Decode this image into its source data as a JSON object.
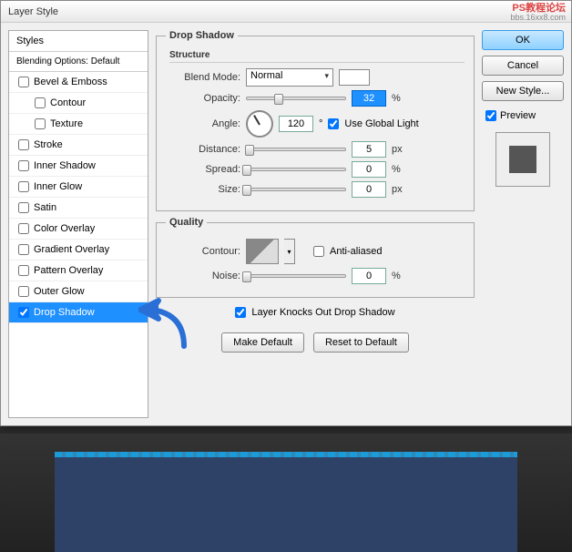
{
  "window": {
    "title": "Layer Style"
  },
  "watermark": {
    "line1": "PS教程论坛",
    "line2": "bbs.16xx8.com"
  },
  "styles": {
    "header": "Styles",
    "blending": "Blending Options: Default",
    "items": [
      {
        "label": "Bevel & Emboss",
        "checked": false,
        "indent": false
      },
      {
        "label": "Contour",
        "checked": false,
        "indent": true
      },
      {
        "label": "Texture",
        "checked": false,
        "indent": true
      },
      {
        "label": "Stroke",
        "checked": false,
        "indent": false
      },
      {
        "label": "Inner Shadow",
        "checked": false,
        "indent": false
      },
      {
        "label": "Inner Glow",
        "checked": false,
        "indent": false
      },
      {
        "label": "Satin",
        "checked": false,
        "indent": false
      },
      {
        "label": "Color Overlay",
        "checked": false,
        "indent": false
      },
      {
        "label": "Gradient Overlay",
        "checked": false,
        "indent": false
      },
      {
        "label": "Pattern Overlay",
        "checked": false,
        "indent": false
      },
      {
        "label": "Outer Glow",
        "checked": false,
        "indent": false
      },
      {
        "label": "Drop Shadow",
        "checked": true,
        "indent": false,
        "selected": true
      }
    ]
  },
  "dropShadow": {
    "legend": "Drop Shadow",
    "structure": "Structure",
    "blendMode": {
      "label": "Blend Mode:",
      "value": "Normal"
    },
    "opacity": {
      "label": "Opacity:",
      "value": "32",
      "unit": "%",
      "pos": 32
    },
    "angle": {
      "label": "Angle:",
      "value": "120",
      "unit": "°",
      "global": "Use Global Light",
      "globalChecked": true
    },
    "distance": {
      "label": "Distance:",
      "value": "5",
      "unit": "px",
      "pos": 3
    },
    "spread": {
      "label": "Spread:",
      "value": "0",
      "unit": "%",
      "pos": 0
    },
    "size": {
      "label": "Size:",
      "value": "0",
      "unit": "px",
      "pos": 0
    },
    "quality": "Quality",
    "contour": {
      "label": "Contour:",
      "antiAliased": "Anti-aliased",
      "aaChecked": false
    },
    "noise": {
      "label": "Noise:",
      "value": "0",
      "unit": "%",
      "pos": 0
    },
    "knockout": {
      "label": "Layer Knocks Out Drop Shadow",
      "checked": true
    },
    "makeDefault": "Make Default",
    "resetDefault": "Reset to Default"
  },
  "buttons": {
    "ok": "OK",
    "cancel": "Cancel",
    "newStyle": "New Style...",
    "preview": "Preview",
    "previewChecked": true
  }
}
